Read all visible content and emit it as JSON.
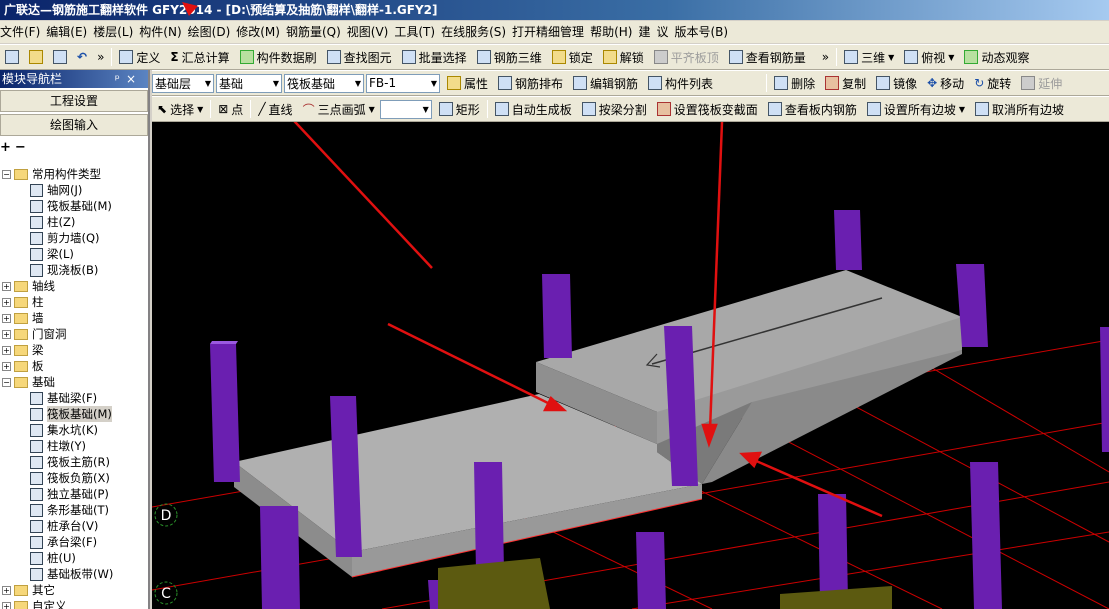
{
  "window": {
    "title": "广联达—钢筋施工翻样软件 GFY2014 - [D:\\预结算及抽筋\\翻样\\翻样-1.GFY2]"
  },
  "menu": [
    "文件(F)",
    "编辑(E)",
    "楼层(L)",
    "构件(N)",
    "绘图(D)",
    "修改(M)",
    "钢筋量(Q)",
    "视图(V)",
    "工具(T)",
    "在线服务(S)",
    "打开精细管理",
    "帮助(H)",
    "建",
    "议",
    "版本号(B)"
  ],
  "toolbar1": {
    "overflow": "»",
    "define": "定义",
    "sum_calc": "汇总计算",
    "sum_icon": "Σ",
    "refresh": "构件数据刷",
    "find": "查找图元",
    "batch_select": "批量选择",
    "rebar_3d": "钢筋三维",
    "lock": "锁定",
    "unlock": "解锁",
    "flush_top": "平齐板顶",
    "view_rebar": "查看钢筋量",
    "view_mode": "三维",
    "view_dir": "俯视",
    "dynamic": "动态观察"
  },
  "toolbar2": {
    "layer": "基础层",
    "category": "基础",
    "type": "筏板基础",
    "element": "FB-1",
    "attr": "属性",
    "rebar_layout": "钢筋排布",
    "edit_rebar": "编辑钢筋",
    "element_list": "构件列表",
    "delete": "删除",
    "copy": "复制",
    "mirror": "镜像",
    "move": "移动",
    "rotate": "旋转",
    "extend": "延伸"
  },
  "toolbar3": {
    "select": "选择",
    "point": "点",
    "line": "直线",
    "arc3": "三点画弧",
    "rect": "矩形",
    "auto_gen": "自动生成板",
    "beam_split": "按梁分割",
    "set_section": "设置筏板变截面",
    "view_inner_rebar": "查看板内钢筋",
    "set_all_slope": "设置所有边坡",
    "cancel_all_slope": "取消所有边坡"
  },
  "sidebar": {
    "title": "模块导航栏",
    "title_pin": "ᵖ",
    "title_close": "×",
    "project_settings": "工程设置",
    "drawing_input": "绘图输入",
    "add_symbol": "+",
    "remove_symbol": "−",
    "common_group": "常用构件类型",
    "common_items": [
      "轴网(J)",
      "筏板基础(M)",
      "柱(Z)",
      "剪力墙(Q)",
      "梁(L)",
      "现浇板(B)"
    ],
    "groups": [
      "轴线",
      "柱",
      "墙",
      "门窗洞",
      "梁",
      "板"
    ],
    "foundation_group": "基础",
    "foundation_items": [
      "基础梁(F)",
      "筏板基础(M)",
      "集水坑(K)",
      "柱墩(Y)",
      "筏板主筋(R)",
      "筏板负筋(X)",
      "独立基础(P)",
      "条形基础(T)",
      "桩承台(V)",
      "承台梁(F)",
      "桩(U)",
      "基础板带(W)"
    ],
    "tail_groups": [
      "其它",
      "自定义"
    ]
  },
  "viewport": {
    "axis_labels": [
      "D",
      "C"
    ],
    "colors": {
      "background": "#000000",
      "slab": "#a9a9a9",
      "column": "#6a1fb0",
      "grid": "#cc0000",
      "cap": "#5c5a10",
      "arrow": "#e01010"
    }
  }
}
